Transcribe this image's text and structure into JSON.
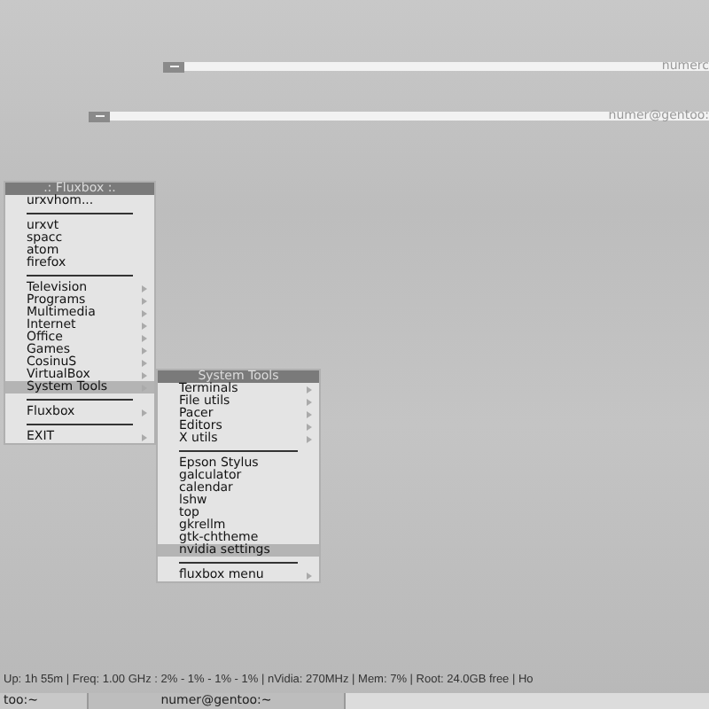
{
  "windows": [
    {
      "title": "numerc"
    },
    {
      "title": "numer@gentoo:"
    }
  ],
  "root_menu": {
    "title": ".: Fluxbox :.",
    "items": [
      {
        "kind": "item",
        "label": "urxvhom...",
        "selected": false
      },
      {
        "kind": "separator"
      },
      {
        "kind": "item",
        "label": "urxvt",
        "selected": false
      },
      {
        "kind": "item",
        "label": "spacc",
        "selected": false
      },
      {
        "kind": "item",
        "label": "atom",
        "selected": false
      },
      {
        "kind": "item",
        "label": "firefox",
        "selected": false
      },
      {
        "kind": "separator"
      },
      {
        "kind": "submenu",
        "label": "Television",
        "selected": false
      },
      {
        "kind": "submenu",
        "label": "Programs",
        "selected": false
      },
      {
        "kind": "submenu",
        "label": "Multimedia",
        "selected": false
      },
      {
        "kind": "submenu",
        "label": "Internet",
        "selected": false
      },
      {
        "kind": "submenu",
        "label": "Office",
        "selected": false
      },
      {
        "kind": "submenu",
        "label": "Games",
        "selected": false
      },
      {
        "kind": "submenu",
        "label": "CosinuS",
        "selected": false
      },
      {
        "kind": "submenu",
        "label": "VirtualBox",
        "selected": false
      },
      {
        "kind": "submenu",
        "label": "System Tools",
        "selected": true
      },
      {
        "kind": "separator"
      },
      {
        "kind": "submenu",
        "label": "Fluxbox",
        "selected": false
      },
      {
        "kind": "separator"
      },
      {
        "kind": "submenu",
        "label": "EXIT",
        "selected": false
      }
    ]
  },
  "sub_menu": {
    "title": "System Tools",
    "items": [
      {
        "kind": "submenu",
        "label": "Terminals",
        "selected": false
      },
      {
        "kind": "submenu",
        "label": "File utils",
        "selected": false
      },
      {
        "kind": "submenu",
        "label": "Pacer",
        "selected": false
      },
      {
        "kind": "submenu",
        "label": "Editors",
        "selected": false
      },
      {
        "kind": "submenu",
        "label": "X utils",
        "selected": false
      },
      {
        "kind": "separator"
      },
      {
        "kind": "item",
        "label": "Epson Stylus",
        "selected": false
      },
      {
        "kind": "item",
        "label": "galculator",
        "selected": false
      },
      {
        "kind": "item",
        "label": "calendar",
        "selected": false
      },
      {
        "kind": "item",
        "label": "lshw",
        "selected": false
      },
      {
        "kind": "item",
        "label": "top",
        "selected": false
      },
      {
        "kind": "item",
        "label": "gkrellm",
        "selected": false
      },
      {
        "kind": "item",
        "label": "gtk-chtheme",
        "selected": false
      },
      {
        "kind": "item",
        "label": "nvidia settings",
        "selected": true
      },
      {
        "kind": "separator"
      },
      {
        "kind": "submenu",
        "label": "fluxbox menu",
        "selected": false
      }
    ]
  },
  "status_bar": "Up: 1h 55m | Freq: 1.00 GHz : 2% - 1% - 1% - 1% | nVidia: 270MHz | Mem: 7% | Root: 24.0GB free | Ho",
  "taskbar": [
    {
      "label": "too:~",
      "selected": false
    },
    {
      "label": "numer@gentoo:~",
      "selected": true
    }
  ]
}
